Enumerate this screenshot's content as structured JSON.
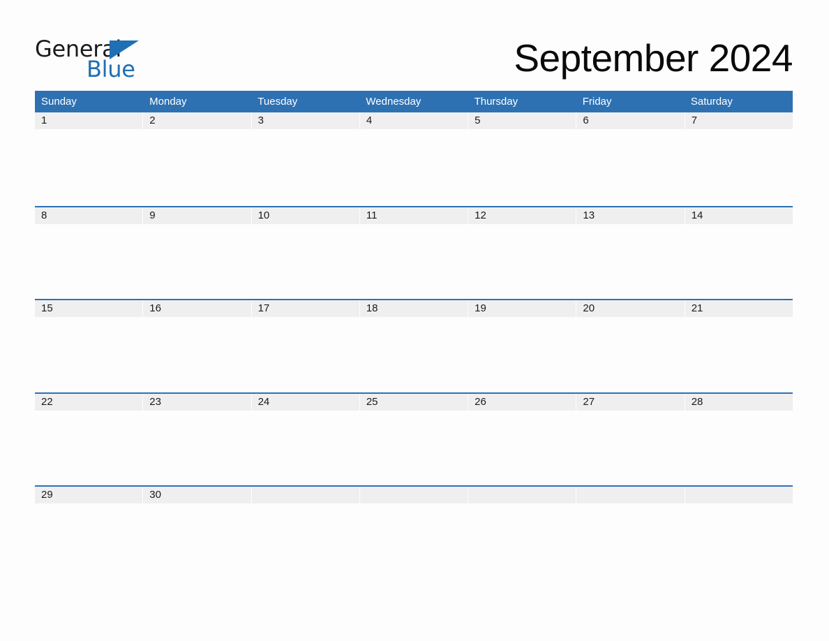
{
  "brand": {
    "name_part1": "General",
    "name_part2": "Blue",
    "triangle_icon": "blue-triangle-icon",
    "color_black": "#1b1b1b",
    "color_blue": "#1f6fb4"
  },
  "header": {
    "title": "September 2024",
    "month": "September",
    "year": "2024"
  },
  "theme": {
    "header_blue": "#2e71b2",
    "date_band_gray": "#efefef",
    "page_background": "#fdfdfd",
    "text_dark": "#1a1a1a",
    "header_text": "#ffffff"
  },
  "calendar": {
    "weekday_headers": [
      "Sunday",
      "Monday",
      "Tuesday",
      "Wednesday",
      "Thursday",
      "Friday",
      "Saturday"
    ],
    "weeks": [
      {
        "days": [
          {
            "date": "1",
            "empty": false
          },
          {
            "date": "2",
            "empty": false
          },
          {
            "date": "3",
            "empty": false
          },
          {
            "date": "4",
            "empty": false
          },
          {
            "date": "5",
            "empty": false
          },
          {
            "date": "6",
            "empty": false
          },
          {
            "date": "7",
            "empty": false
          }
        ]
      },
      {
        "days": [
          {
            "date": "8",
            "empty": false
          },
          {
            "date": "9",
            "empty": false
          },
          {
            "date": "10",
            "empty": false
          },
          {
            "date": "11",
            "empty": false
          },
          {
            "date": "12",
            "empty": false
          },
          {
            "date": "13",
            "empty": false
          },
          {
            "date": "14",
            "empty": false
          }
        ]
      },
      {
        "days": [
          {
            "date": "15",
            "empty": false
          },
          {
            "date": "16",
            "empty": false
          },
          {
            "date": "17",
            "empty": false
          },
          {
            "date": "18",
            "empty": false
          },
          {
            "date": "19",
            "empty": false
          },
          {
            "date": "20",
            "empty": false
          },
          {
            "date": "21",
            "empty": false
          }
        ]
      },
      {
        "days": [
          {
            "date": "22",
            "empty": false
          },
          {
            "date": "23",
            "empty": false
          },
          {
            "date": "24",
            "empty": false
          },
          {
            "date": "25",
            "empty": false
          },
          {
            "date": "26",
            "empty": false
          },
          {
            "date": "27",
            "empty": false
          },
          {
            "date": "28",
            "empty": false
          }
        ]
      },
      {
        "days": [
          {
            "date": "29",
            "empty": false
          },
          {
            "date": "30",
            "empty": false
          },
          {
            "date": "",
            "empty": true
          },
          {
            "date": "",
            "empty": true
          },
          {
            "date": "",
            "empty": true
          },
          {
            "date": "",
            "empty": true
          },
          {
            "date": "",
            "empty": true
          }
        ]
      }
    ]
  }
}
